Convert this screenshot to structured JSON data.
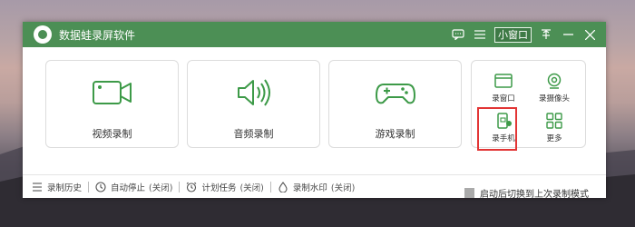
{
  "window": {
    "title": "数据蛙录屏软件"
  },
  "titlebar": {
    "mini_window_label": "小窗口",
    "controls": [
      "chat-icon",
      "menu-icon",
      "pin-icon",
      "minimize-icon",
      "close-icon"
    ]
  },
  "modes": [
    {
      "label": "视频录制",
      "icon": "video-camera-icon"
    },
    {
      "label": "音频录制",
      "icon": "speaker-icon"
    },
    {
      "label": "游戏录制",
      "icon": "gamepad-icon"
    }
  ],
  "mini_modes": [
    {
      "label": "录窗口",
      "icon": "window-icon"
    },
    {
      "label": "录摄像头",
      "icon": "webcam-icon"
    },
    {
      "label": "录手机",
      "icon": "phone-icon"
    },
    {
      "label": "更多",
      "icon": "grid-icon"
    }
  ],
  "startup_option": {
    "label": "启动后切换到上次录制模式",
    "checked": false
  },
  "footer": {
    "history": "录制历史",
    "auto_stop": "自动停止",
    "auto_stop_status": "(关闭)",
    "schedule": "计划任务",
    "schedule_status": "(关闭)",
    "watermark": "录制水印",
    "watermark_status": "(关闭)"
  },
  "colors": {
    "brand_green": "#4c8f55",
    "icon_green": "#3d9a48",
    "highlight_red": "#e23535"
  }
}
